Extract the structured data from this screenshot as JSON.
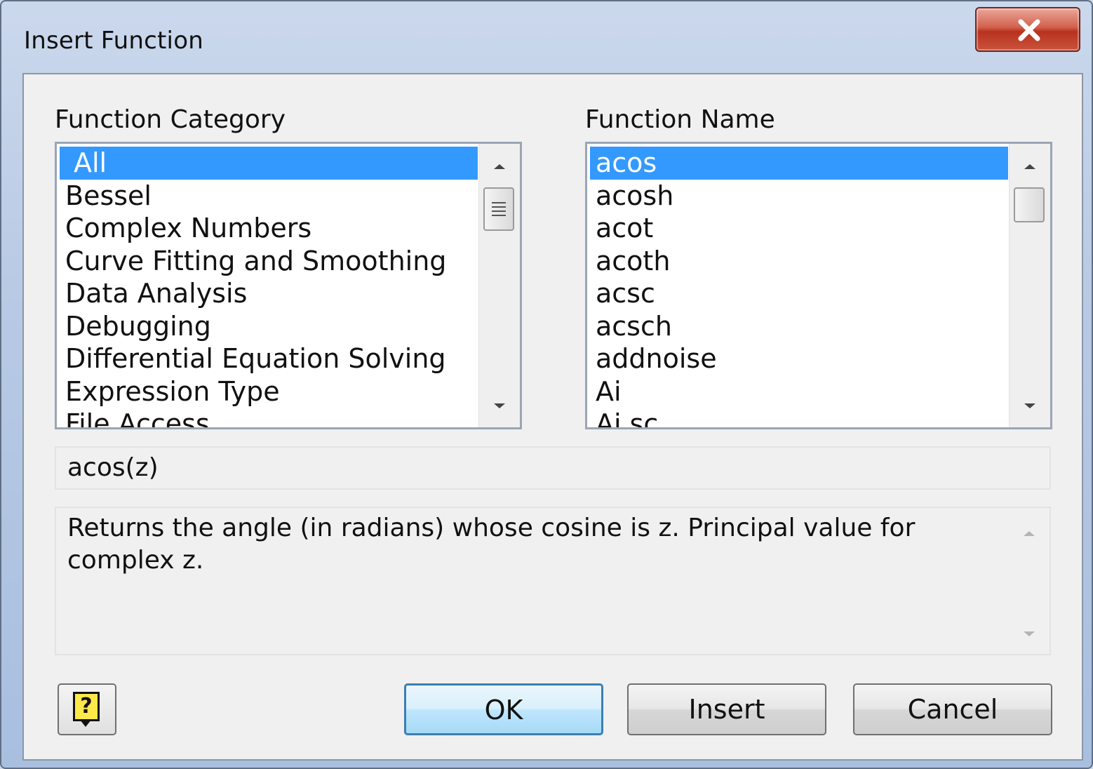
{
  "window": {
    "title": "Insert Function",
    "close_glyph": "✕"
  },
  "category": {
    "label": "Function Category",
    "items": [
      "All",
      "Bessel",
      "Complex Numbers",
      "Curve Fitting and Smoothing",
      "Data Analysis",
      "Debugging",
      "Differential Equation Solving",
      "Expression Type",
      "File Access"
    ],
    "selected": "All"
  },
  "function_name": {
    "label": "Function Name",
    "items": [
      "acos",
      "acosh",
      "acot",
      "acoth",
      "acsc",
      "acsch",
      "addnoise",
      "Ai",
      "Ai.sc"
    ],
    "selected": "acos"
  },
  "syntax": "acos(z)",
  "description": "Returns the angle (in radians) whose cosine is z. Principal value for complex z.",
  "buttons": {
    "help_glyph": "?",
    "ok": "OK",
    "insert": "Insert",
    "cancel": "Cancel"
  },
  "icons": {
    "close": "close-icon",
    "help": "help-icon",
    "scroll_up": "scroll-up-arrow-icon",
    "scroll_down": "scroll-down-arrow-icon"
  },
  "colors": {
    "selection": "#3399ff",
    "close_button": "#c9533c",
    "default_button_border": "#3c7fb1"
  }
}
